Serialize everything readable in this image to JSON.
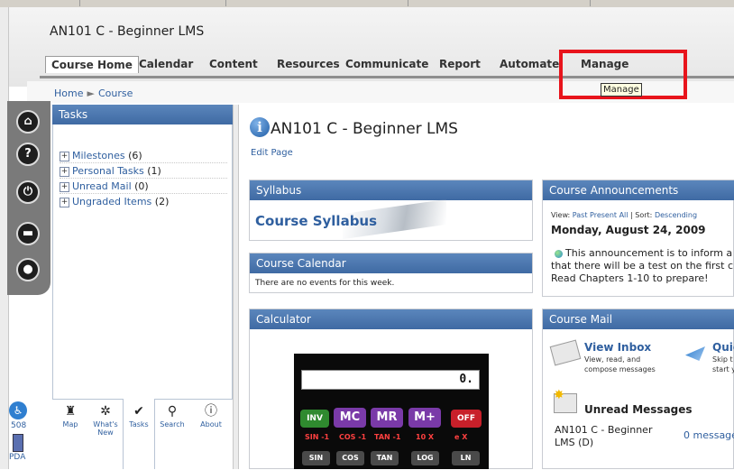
{
  "header": {
    "course_title": "AN101 C - Beginner LMS",
    "nav_tabs": [
      "Course Home",
      "Calendar",
      "Content",
      "Resources",
      "Communicate",
      "Report",
      "Automate",
      "Manage"
    ],
    "tooltip": "Manage",
    "highlight_color": "#e8141c"
  },
  "breadcrumb": {
    "home": "Home",
    "separator": "►",
    "current": "Course"
  },
  "rail": {
    "icons": [
      "home-icon",
      "help-icon",
      "power-icon",
      "folder-icon",
      "profile-icon"
    ],
    "accessibility_label": "508",
    "pda_label": "PDA"
  },
  "tasks": {
    "title": "Tasks",
    "items": [
      {
        "label": "Milestones",
        "count": "(6)"
      },
      {
        "label": "Personal Tasks",
        "count": "(1)"
      },
      {
        "label": "Unread Mail",
        "count": "(0)"
      },
      {
        "label": "Ungraded Items",
        "count": "(2)"
      }
    ],
    "bottom_tabs": [
      {
        "label": "Map",
        "icon": "map-icon"
      },
      {
        "label": "What's New",
        "icon": "whats-new-icon"
      },
      {
        "label": "Tasks",
        "icon": "check-icon"
      },
      {
        "label": "Search",
        "icon": "search-icon"
      },
      {
        "label": "About",
        "icon": "info-icon"
      }
    ]
  },
  "main": {
    "title": "AN101 C - Beginner LMS",
    "edit_page": "Edit Page",
    "syllabus": {
      "title": "Syllabus",
      "link": "Course Syllabus"
    },
    "calendar": {
      "title": "Course Calendar",
      "text": "There are no events for this week."
    },
    "calculator": {
      "title": "Calculator",
      "display": "0.",
      "row1": [
        "INV",
        "MC",
        "MR",
        "M+",
        "OFF"
      ],
      "row2": [
        "SIN -1",
        "COS -1",
        "TAN -1",
        "10 X",
        "e X"
      ],
      "row3": [
        "SIN",
        "COS",
        "TAN",
        "LOG",
        "LN"
      ]
    },
    "announcements": {
      "title": "Course Announcements",
      "view_label": "View:",
      "view_past": "Past",
      "view_present": "Present",
      "view_all": "All",
      "sort_label": "| Sort:",
      "sort_value": "Descending",
      "date": "Monday, August 24, 2009",
      "line1": "This announcement is to inform a",
      "line2": "that there will be a test on the first c",
      "line3": "Read Chapters 1-10 to prepare!"
    },
    "mail": {
      "title": "Course Mail",
      "inbox_title": "View Inbox",
      "inbox_sub": "View, read, and compose messages",
      "quick_title": "Quic",
      "quick_sub1": "Skip t",
      "quick_sub2": "start y",
      "unread_title": "Unread Messages",
      "course": "AN101 C - Beginner LMS (D)",
      "count": "0 message"
    }
  }
}
